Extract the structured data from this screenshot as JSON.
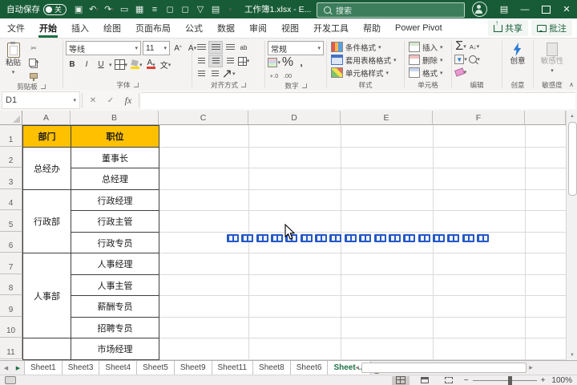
{
  "titlebar": {
    "autosave_label": "自动保存",
    "autosave_state": "关",
    "doc_title": "工作簿1.xlsx - E...",
    "search_placeholder": "搜索"
  },
  "ribbon_tabs": [
    {
      "label": "文件",
      "active": false
    },
    {
      "label": "开始",
      "active": true
    },
    {
      "label": "插入",
      "active": false
    },
    {
      "label": "绘图",
      "active": false
    },
    {
      "label": "页面布局",
      "active": false
    },
    {
      "label": "公式",
      "active": false
    },
    {
      "label": "数据",
      "active": false
    },
    {
      "label": "审阅",
      "active": false
    },
    {
      "label": "视图",
      "active": false
    },
    {
      "label": "开发工具",
      "active": false
    },
    {
      "label": "帮助",
      "active": false
    },
    {
      "label": "Power Pivot",
      "active": false
    }
  ],
  "tab_actions": {
    "share": "共享",
    "comments": "批注"
  },
  "ribbon": {
    "clipboard": {
      "paste": "粘贴",
      "label": "剪贴板"
    },
    "font": {
      "name": "等线",
      "size": "11",
      "label": "字体"
    },
    "alignment": {
      "label": "对齐方式"
    },
    "number": {
      "format": "常规",
      "label": "数字"
    },
    "styles": {
      "conditional": "条件格式",
      "format_table": "套用表格格式",
      "cell_styles": "单元格样式",
      "label": "样式"
    },
    "cells": {
      "insert": "插入",
      "delete": "删除",
      "format": "格式",
      "label": "单元格"
    },
    "editing": {
      "label": "编辑"
    },
    "ideas": {
      "button": "创意",
      "label": "创意"
    },
    "sensitivity": {
      "button": "敏感性",
      "label": "敏感度"
    }
  },
  "icons": {
    "caret": "▾",
    "caret_up": "∧",
    "undo": "↶",
    "redo": "↷",
    "save": "▣",
    "screen": "▭",
    "grid": "▦",
    "lines": "≡",
    "box": "◻",
    "funnel": "▽",
    "panel": "▤",
    "close": "✕",
    "check": "✓",
    "fx": "fx",
    "sum": "Σ",
    "percent": "%",
    "comma": ",",
    "inc_dec": "+.0",
    "dec_dec": ".00",
    "bold": "B",
    "italic": "I",
    "underline": "U",
    "wrap": "ab",
    "orient": "↗",
    "phonetic": "文",
    "cut": "✂",
    "sort": "A↓",
    "minus": "—",
    "x": "✕",
    "left": "◀",
    "right": "▶",
    "up": "▲",
    "down": "▼",
    "plus": "+",
    "zoom_minus": "−",
    "zoom_plus": "+"
  },
  "formula_bar": {
    "name_box": "D1"
  },
  "grid": {
    "columns": [
      "A",
      "B",
      "C",
      "D",
      "E",
      "F"
    ],
    "rows": [
      "1",
      "2",
      "3",
      "4",
      "5",
      "6",
      "7",
      "8",
      "9",
      "10",
      "11"
    ]
  },
  "table": {
    "headers": [
      "部门",
      "职位"
    ],
    "groups": [
      {
        "dept": "总经办",
        "positions": [
          "董事长",
          "总经理"
        ]
      },
      {
        "dept": "行政部",
        "positions": [
          "行政经理",
          "行政主管",
          "行政专员"
        ]
      },
      {
        "dept": "人事部",
        "positions": [
          "人事经理",
          "人事主管",
          "薪酬专员",
          "招聘专员"
        ]
      },
      {
        "dept": "",
        "positions": [
          "市场经理"
        ]
      }
    ]
  },
  "chips": {
    "count": 18,
    "color": "#2458c6"
  },
  "sheet_bar": {
    "tabs": [
      "Sheet1",
      "Sheet3",
      "Sheet4",
      "Sheet5",
      "Sheet9",
      "Sheet11",
      "Sheet8",
      "Sheet6",
      "Sheet ..."
    ],
    "active_index": 8
  },
  "status_bar": {
    "zoom": "100%"
  }
}
